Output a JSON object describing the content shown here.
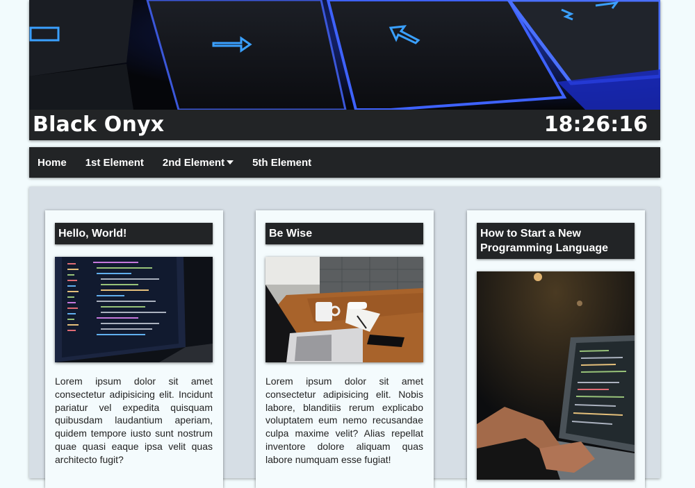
{
  "site": {
    "title": "Black Onyx",
    "clock": "18:26:16"
  },
  "nav": {
    "items": [
      {
        "label": "Home"
      },
      {
        "label": "1st Element"
      },
      {
        "label": "2nd Element"
      },
      {
        "label": "5th Element"
      }
    ]
  },
  "cards": [
    {
      "title": "Hello, World!",
      "text": "Lorem ipsum dolor sit amet consectetur adipisicing elit. Incidunt pariatur vel expedita quisquam quibusdam laudantium aperiam, quidem tempore iusto sunt nostrum quae quasi eaque ipsa velit quas architecto fugit?"
    },
    {
      "title": "Be Wise",
      "text": "Lorem ipsum dolor sit amet consectetur adipisicing elit. Nobis labore, blanditiis rerum explicabo voluptatem eum nemo recusandae culpa maxime velit? Alias repellat inventore dolore aliquam quas labore numquam esse fugiat!"
    },
    {
      "title": "How to Start a New Programming Language"
    }
  ],
  "colors": {
    "panel": "#222426",
    "page": "#f2fbfd",
    "main": "#d6dee5",
    "keyglow": "#2a6bff"
  }
}
